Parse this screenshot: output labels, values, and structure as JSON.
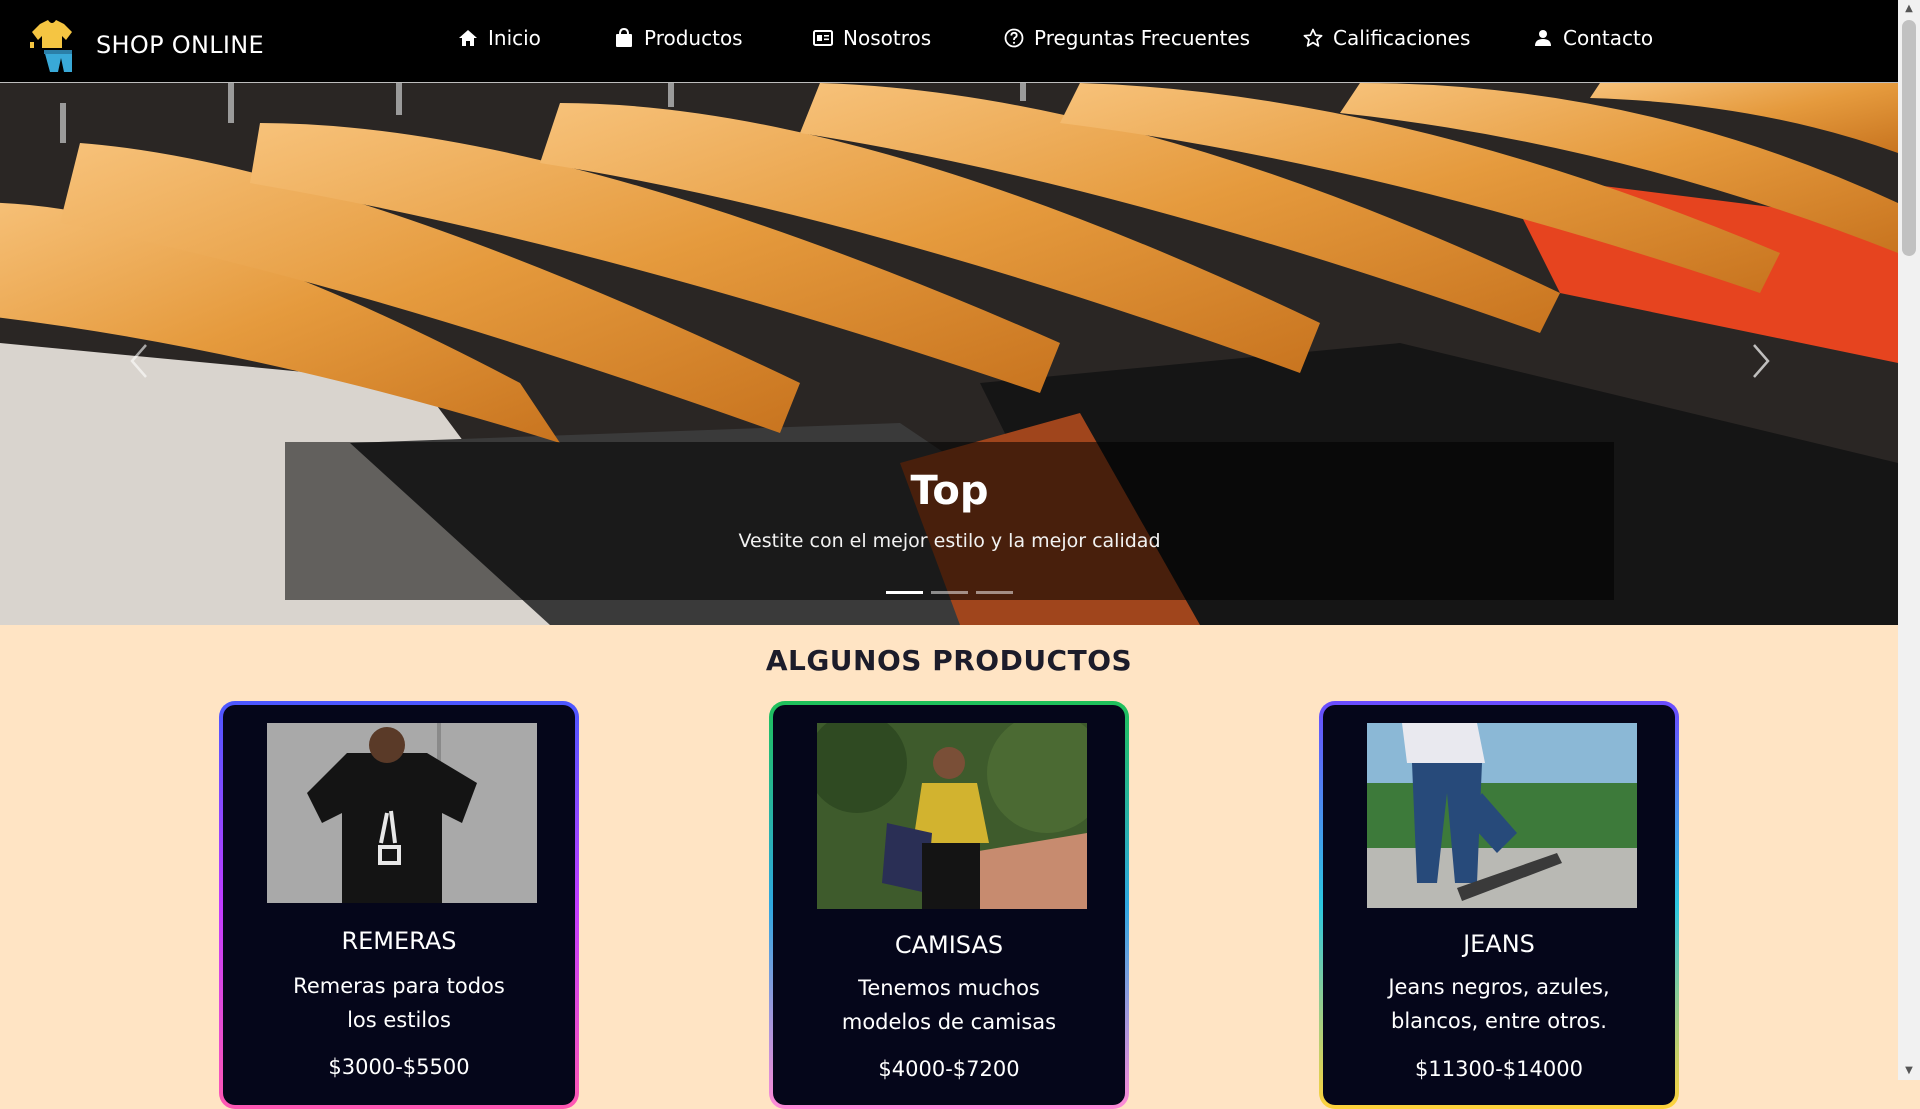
{
  "brand": {
    "name": "SHOP ONLINE",
    "logo_icon": "clothes-logo-icon"
  },
  "nav": {
    "items": [
      {
        "label": "Inicio",
        "icon": "home-icon"
      },
      {
        "label": "Productos",
        "icon": "bag-icon"
      },
      {
        "label": "Nosotros",
        "icon": "id-card-icon"
      },
      {
        "label": "Preguntas Frecuentes",
        "icon": "question-circle-icon"
      },
      {
        "label": "Calificaciones",
        "icon": "star-icon"
      },
      {
        "label": "Contacto",
        "icon": "user-icon"
      }
    ]
  },
  "hero": {
    "title": "Top",
    "text": "Vestite con el mejor estilo y la mejor calidad",
    "slides": 3,
    "active_slide": 1
  },
  "products": {
    "title": "ALGUNOS PRODUCTOS",
    "items": [
      {
        "name": "REMERAS",
        "desc": "Remeras para todos los estilos",
        "price": "$3000-$5500"
      },
      {
        "name": "CAMISAS",
        "desc": "Tenemos muchos modelos de camisas",
        "price": "$4000-$7200"
      },
      {
        "name": "JEANS",
        "desc": "Jeans negros, azules, blancos, entre otros.",
        "price": "$11300-$14000"
      }
    ]
  },
  "colors": {
    "navbar": "#000000",
    "page_bg": "#ffe4c4",
    "card_bg": "#05061a"
  }
}
